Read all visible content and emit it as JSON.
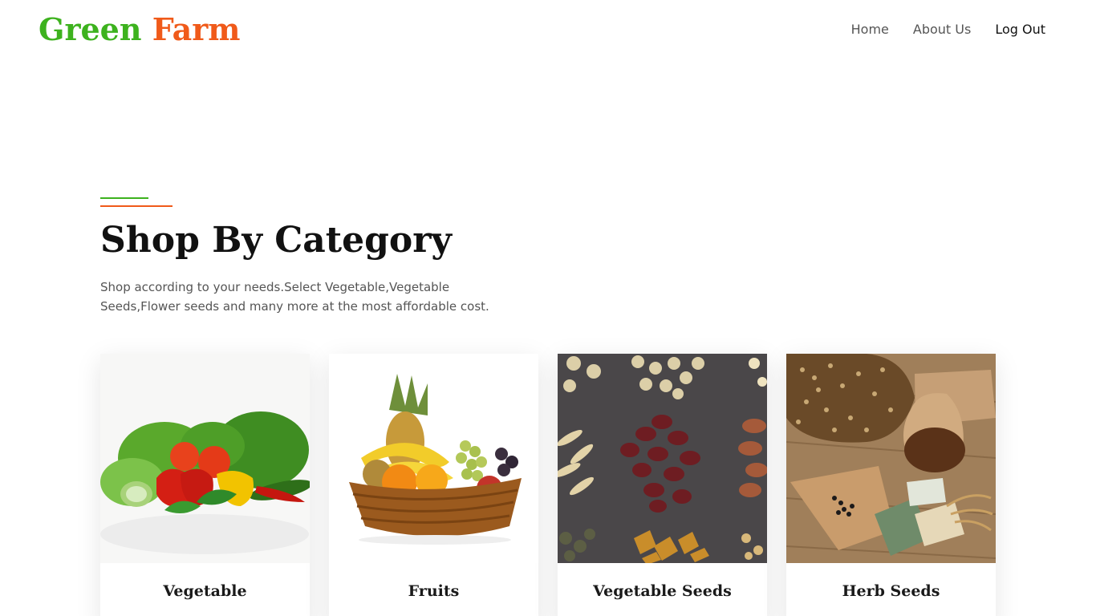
{
  "brand": {
    "word1": "Green",
    "word2": "Farm"
  },
  "nav": {
    "home": "Home",
    "about": "About Us",
    "logout": "Log Out"
  },
  "section": {
    "heading": "Shop By Category",
    "description": "Shop according to your needs.Select Vegetable,Vegetable Seeds,Flower seeds and many more at the most affordable cost."
  },
  "categories": [
    {
      "label": "Vegetable",
      "image": "vegetables-photo"
    },
    {
      "label": "Fruits",
      "image": "fruit-basket-photo"
    },
    {
      "label": "Vegetable Seeds",
      "image": "vegetable-seeds-photo"
    },
    {
      "label": "Herb Seeds",
      "image": "herb-seeds-photo"
    }
  ],
  "colors": {
    "brand_green": "#3db21e",
    "brand_orange": "#f05a1a"
  }
}
